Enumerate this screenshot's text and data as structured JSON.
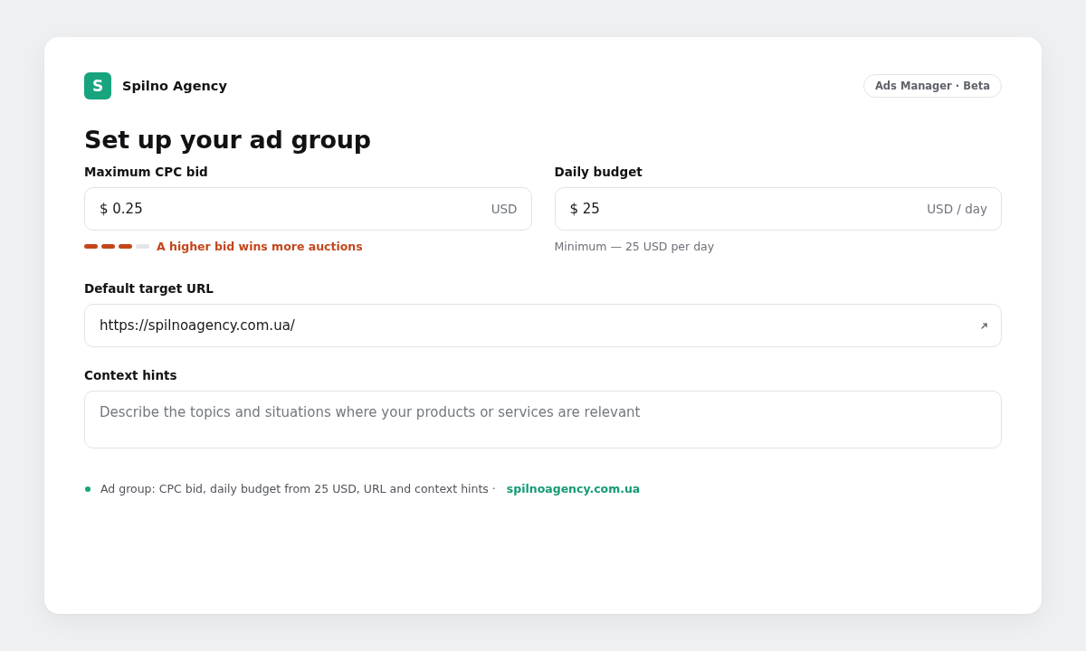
{
  "brand": {
    "logo_letter": "S",
    "name": "Spilno Agency"
  },
  "badge": "Ads Manager · Beta",
  "title": "Set up your ad group",
  "fields": [
    {
      "kind": "money",
      "label": "Maximum CPC bid",
      "value": "$ 0.25",
      "suffix": "USD",
      "strength": {
        "level": 0.75,
        "text": "A higher bid wins more auctions"
      }
    },
    {
      "kind": "money",
      "label": "Daily budget",
      "value": "$ 25",
      "suffix": "USD / day",
      "hint": "Minimum — 25 USD per day"
    },
    {
      "kind": "url",
      "label": "Default target URL",
      "value": "https://spilnoagency.com.ua/"
    },
    {
      "kind": "textarea",
      "label": "Context hints",
      "placeholder": "Describe the topics and situations where your products or services are relevant"
    }
  ],
  "footer": {
    "text": "Ad group: CPC bid, daily budget from 25 USD, URL and context hints ·",
    "link": "spilnoagency.com.ua"
  }
}
